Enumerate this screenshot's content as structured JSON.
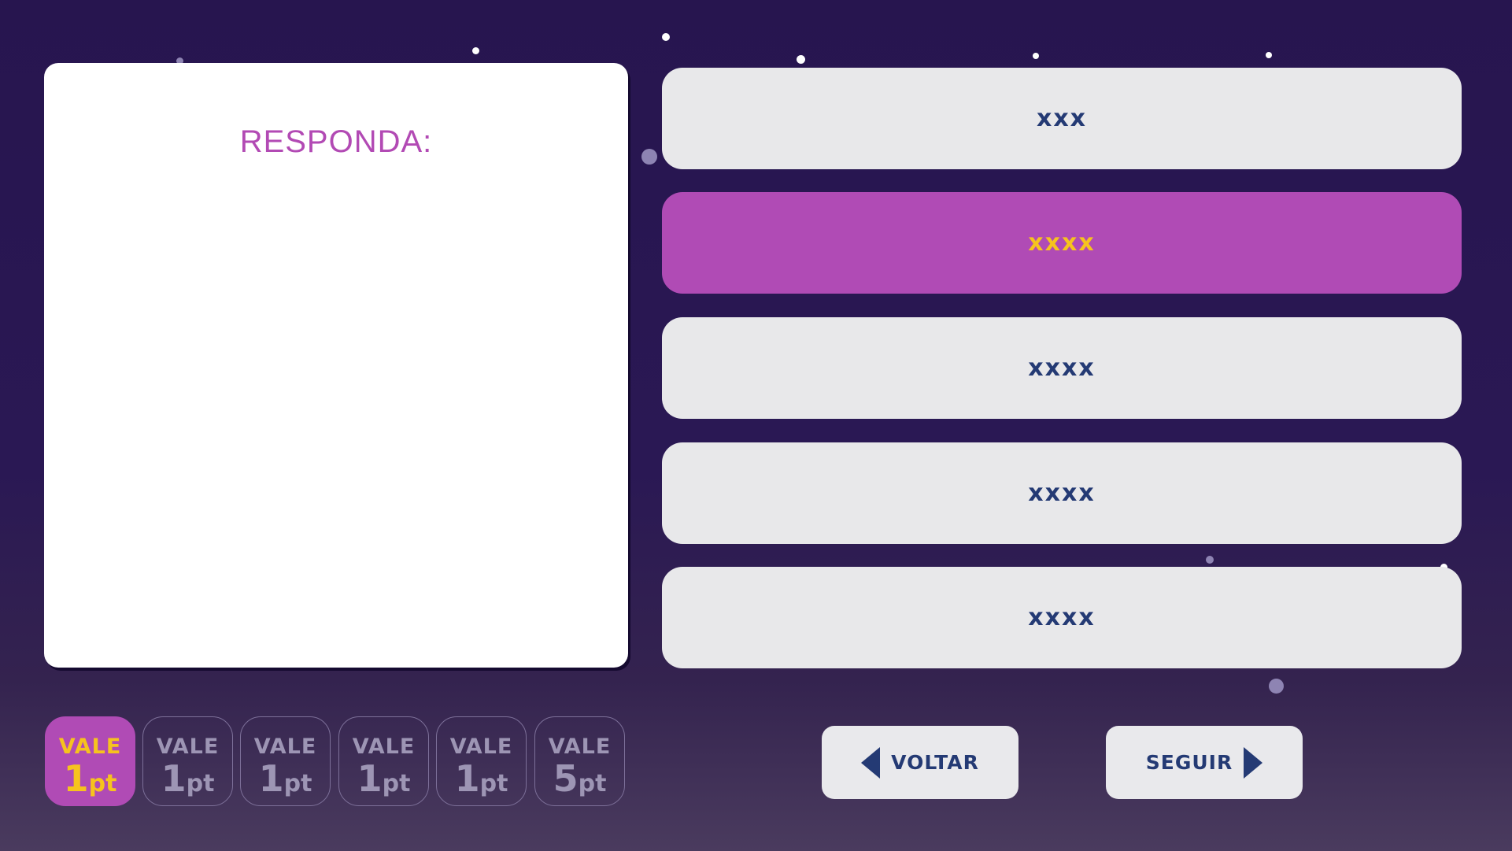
{
  "question": {
    "label": "RESPONDA:"
  },
  "answers": [
    {
      "text": "xxx",
      "selected": false
    },
    {
      "text": "xxxx",
      "selected": true
    },
    {
      "text": "xxxx",
      "selected": false
    },
    {
      "text": "xxxx",
      "selected": false
    },
    {
      "text": "xxxx",
      "selected": false
    }
  ],
  "points": [
    {
      "vale": "VALE",
      "num": "1",
      "unit": "pt",
      "active": true
    },
    {
      "vale": "VALE",
      "num": "1",
      "unit": "pt",
      "active": false
    },
    {
      "vale": "VALE",
      "num": "1",
      "unit": "pt",
      "active": false
    },
    {
      "vale": "VALE",
      "num": "1",
      "unit": "pt",
      "active": false
    },
    {
      "vale": "VALE",
      "num": "1",
      "unit": "pt",
      "active": false
    },
    {
      "vale": "VALE",
      "num": "5",
      "unit": "pt",
      "active": false
    }
  ],
  "nav": {
    "back_label": "VOLTAR",
    "next_label": "SEGUIR"
  },
  "colors": {
    "accent": "#b04bb5",
    "highlight": "#f6c31e",
    "text_dark": "#243a74",
    "background": "#27154f"
  }
}
